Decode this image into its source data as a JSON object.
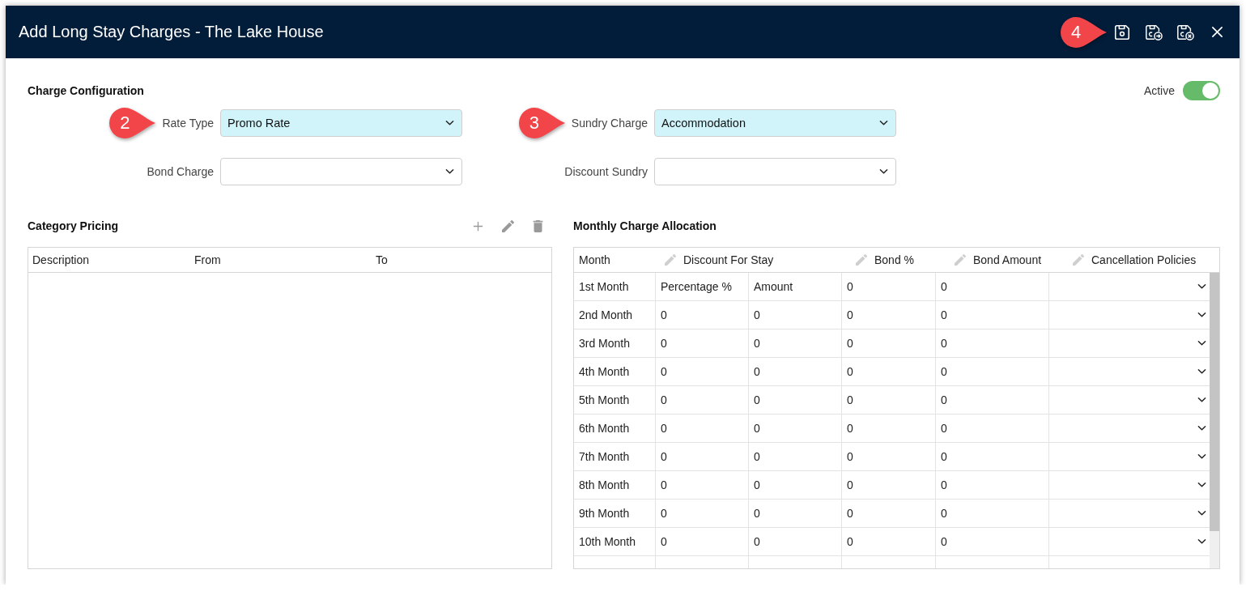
{
  "window": {
    "title": "Add Long Stay Charges - The Lake House",
    "callout": "4"
  },
  "charge_configuration": {
    "title": "Charge Configuration",
    "active": {
      "label": "Active",
      "on": true
    },
    "fields": [
      {
        "label": "Rate Type",
        "value": "Promo Rate",
        "highlighted": true,
        "callout": "2"
      },
      {
        "label": "Sundry Charge",
        "value": "Accommodation",
        "highlighted": true,
        "callout": "3"
      },
      {
        "label": "Bond Charge",
        "highlighted": false
      },
      {
        "label": "Discount Sundry",
        "highlighted": false
      }
    ]
  },
  "category_pricing": {
    "title": "Category Pricing",
    "columns": [
      "Description",
      "From",
      "To"
    ]
  },
  "monthly_charge_allocation": {
    "title": "Monthly Charge Allocation",
    "columns": [
      {
        "label": "Month",
        "editable": false
      },
      {
        "label": "Discount For Stay",
        "editable": true
      },
      {
        "label": "Bond %",
        "editable": true
      },
      {
        "label": "Bond Amount",
        "editable": true
      },
      {
        "label": "Cancellation Policies",
        "editable": true
      }
    ],
    "rows": [
      {
        "month": "1st Month",
        "percentage": "Percentage %",
        "amount": "Amount",
        "bond_percent": "0",
        "bond_amount": "0"
      },
      {
        "month": "2nd Month",
        "percentage": "0",
        "amount": "0",
        "bond_percent": "0",
        "bond_amount": "0"
      },
      {
        "month": "3rd Month",
        "percentage": "0",
        "amount": "0",
        "bond_percent": "0",
        "bond_amount": "0"
      },
      {
        "month": "4th Month",
        "percentage": "0",
        "amount": "0",
        "bond_percent": "0",
        "bond_amount": "0"
      },
      {
        "month": "5th Month",
        "percentage": "0",
        "amount": "0",
        "bond_percent": "0",
        "bond_amount": "0"
      },
      {
        "month": "6th Month",
        "percentage": "0",
        "amount": "0",
        "bond_percent": "0",
        "bond_amount": "0"
      },
      {
        "month": "7th Month",
        "percentage": "0",
        "amount": "0",
        "bond_percent": "0",
        "bond_amount": "0"
      },
      {
        "month": "8th Month",
        "percentage": "0",
        "amount": "0",
        "bond_percent": "0",
        "bond_amount": "0"
      },
      {
        "month": "9th Month",
        "percentage": "0",
        "amount": "0",
        "bond_percent": "0",
        "bond_amount": "0"
      },
      {
        "month": "10th Month",
        "percentage": "0",
        "amount": "0",
        "bond_percent": "0",
        "bond_amount": "0"
      }
    ]
  }
}
